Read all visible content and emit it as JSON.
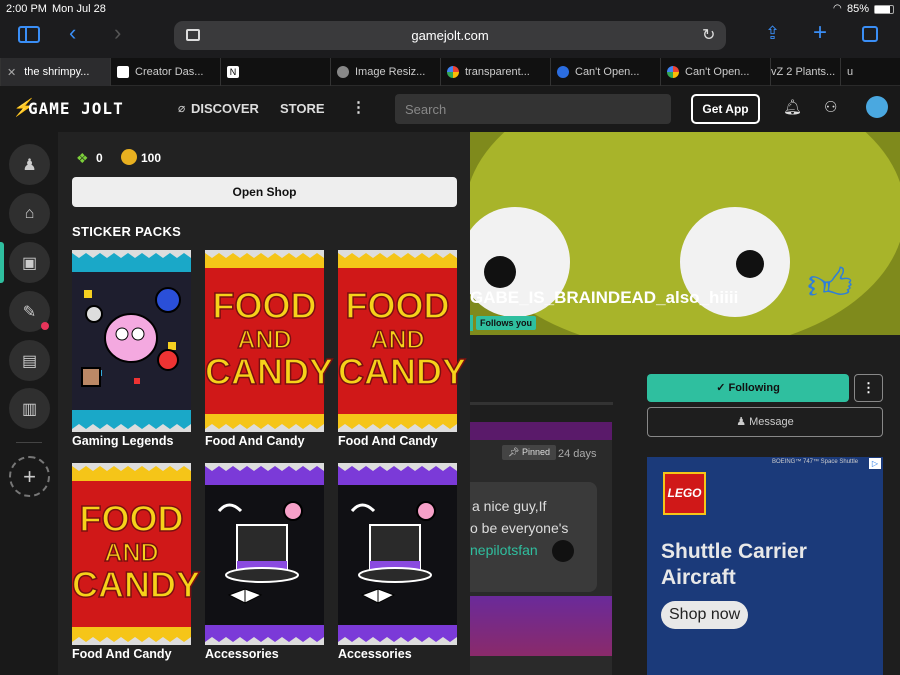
{
  "status": {
    "time": "2:00 PM",
    "date": "Mon Jul 28",
    "battery": "85%"
  },
  "browser": {
    "url": "gamejolt.com"
  },
  "tabs": [
    {
      "label": "the shrimpy..."
    },
    {
      "label": "Creator Das..."
    },
    {
      "label": ""
    },
    {
      "label": "Image Resiz..."
    },
    {
      "label": "transparent..."
    },
    {
      "label": "Can't Open..."
    },
    {
      "label": "Can't Open..."
    },
    {
      "label": "vZ 2 Plants..."
    },
    {
      "label": "u"
    }
  ],
  "nav": {
    "logo": "GAME JOLT",
    "discover": "DISCOVER",
    "store": "STORE",
    "search_placeholder": "Search",
    "get_app": "Get App"
  },
  "wallet": {
    "gems": "0",
    "coins": "100",
    "open_shop": "Open Shop"
  },
  "section_title": "STICKER PACKS",
  "packs": [
    {
      "label": "Gaming Legends",
      "color": "#1aa8c8"
    },
    {
      "label": "Food And Candy",
      "color": "#d01818"
    },
    {
      "label": "Food And Candy",
      "color": "#d01818"
    },
    {
      "label": "Food And Candy",
      "color": "#d01818"
    },
    {
      "label": "Accessories",
      "color": "#7b3ad8"
    },
    {
      "label": "Accessories",
      "color": "#7b3ad8"
    }
  ],
  "pack_art": {
    "food": "FOOD",
    "and": "AND",
    "candy": "CANDY"
  },
  "profile": {
    "username": "GABE_IS_BRAINDEAD_also_hiiii",
    "follows_you": "Follows you",
    "following": "Following",
    "message": "Message"
  },
  "post": {
    "pinned": "Pinned",
    "age": "24 days",
    "text1": "a nice guy,If",
    "text2": "o be everyone's",
    "mention": "nepilotsfan"
  },
  "ad": {
    "brand": "LEGO",
    "line1": "Shuttle Carrier",
    "line2": "Aircraft",
    "cta": "Shop now",
    "top": "BOEING™ 747™ Space Shuttle"
  },
  "colors": {
    "accent": "#2fbf9f",
    "bg": "#191919",
    "panel": "#222222"
  }
}
